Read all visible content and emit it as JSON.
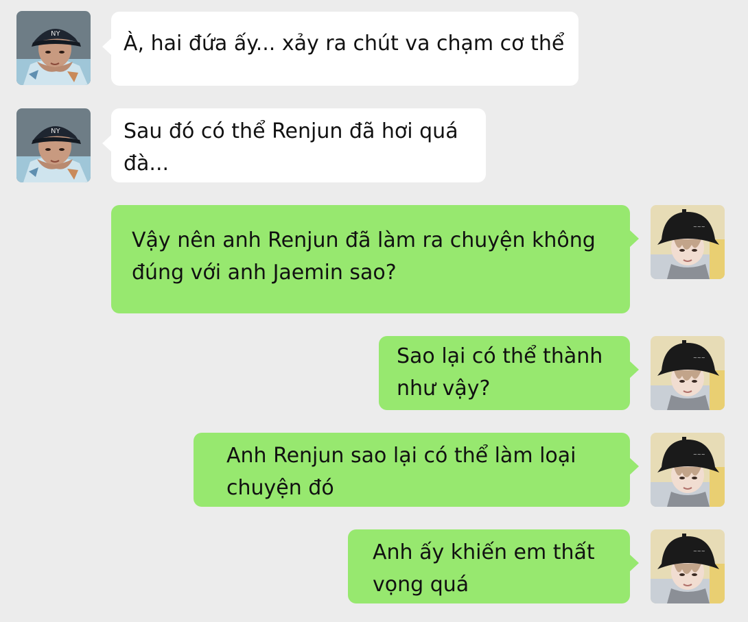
{
  "conversation": {
    "messages": [
      {
        "side": "incoming",
        "text": "À, hai đứa ấy... xảy ra chút va chạm cơ thể",
        "avatar_icon": "person-avatar-cap-icon"
      },
      {
        "side": "incoming",
        "text": "Sau đó có thể Renjun đã hơi quá đà...",
        "avatar_icon": "person-avatar-cap-icon"
      },
      {
        "side": "outgoing",
        "text": "Vậy nên anh Renjun đã làm ra chuyện không đúng với anh Jaemin sao?",
        "avatar_icon": "person-avatar-bucket-hat-icon"
      },
      {
        "side": "outgoing",
        "text": "Sao lại có thể thành như vậy?",
        "avatar_icon": "person-avatar-bucket-hat-icon"
      },
      {
        "side": "outgoing",
        "text": "Anh Renjun sao lại có thể làm loại chuyện đó",
        "avatar_icon": "person-avatar-bucket-hat-icon"
      },
      {
        "side": "outgoing",
        "text": "Anh ấy khiến em thất vọng quá",
        "avatar_icon": "person-avatar-bucket-hat-icon"
      }
    ]
  },
  "colors": {
    "background": "#ececec",
    "incoming_bubble": "#ffffff",
    "outgoing_bubble": "#97e86f",
    "text": "#111111"
  }
}
